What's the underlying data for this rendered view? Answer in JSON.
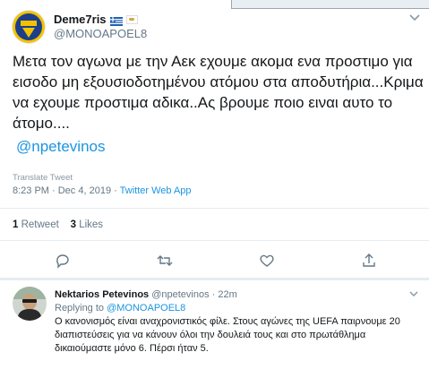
{
  "tweet": {
    "display_name": "Deme7ris",
    "handle": "@MONOAPOEL8",
    "text": "Μετα τον αγωνα με την Αεκ εχουμε ακομα ενα προστιμο για εισοδο μη εξουσιοδοτημένου ατόμου στα αποδυτήρια...Κριμα να εχουμε προστιμα αδικα..Ας βρουμε ποιο ειναι αυτο το άτομο....",
    "mention": "@npetevinos",
    "translate_label": "Translate Tweet",
    "timestamp": "8:23 PM · Dec 4, 2019 · ",
    "source": "Twitter Web App",
    "retweets_count": "1",
    "retweets_label": "Retweet",
    "likes_count": "3",
    "likes_label": "Likes"
  },
  "reply": {
    "display_name": "Nektarios Petevinos",
    "handle_time": "@npetevinos · 22m",
    "replying_prefix": "Replying to ",
    "replying_to": "@MONOAPOEL8",
    "text": "Ο κανονισμός είναι αναχρονιστικός φίλε. Στους αγώνες της UEFA παιρνουμε 20 διαπιστεύσεις για να κάνουν όλοι την δουλειά τους και στο πρωτάθλημα δικαιούμαστε μόνο 6. Πέρσι ήταν 5."
  },
  "icons": [
    "chevron-down-icon",
    "reply-icon",
    "retweet-icon",
    "like-icon",
    "share-icon"
  ],
  "colors": {
    "link": "#1b95e0",
    "muted": "#657786",
    "text": "#14171a",
    "divider": "#e6ecf0",
    "apoel_yellow": "#f2c200",
    "apoel_blue": "#1d3f8a"
  }
}
